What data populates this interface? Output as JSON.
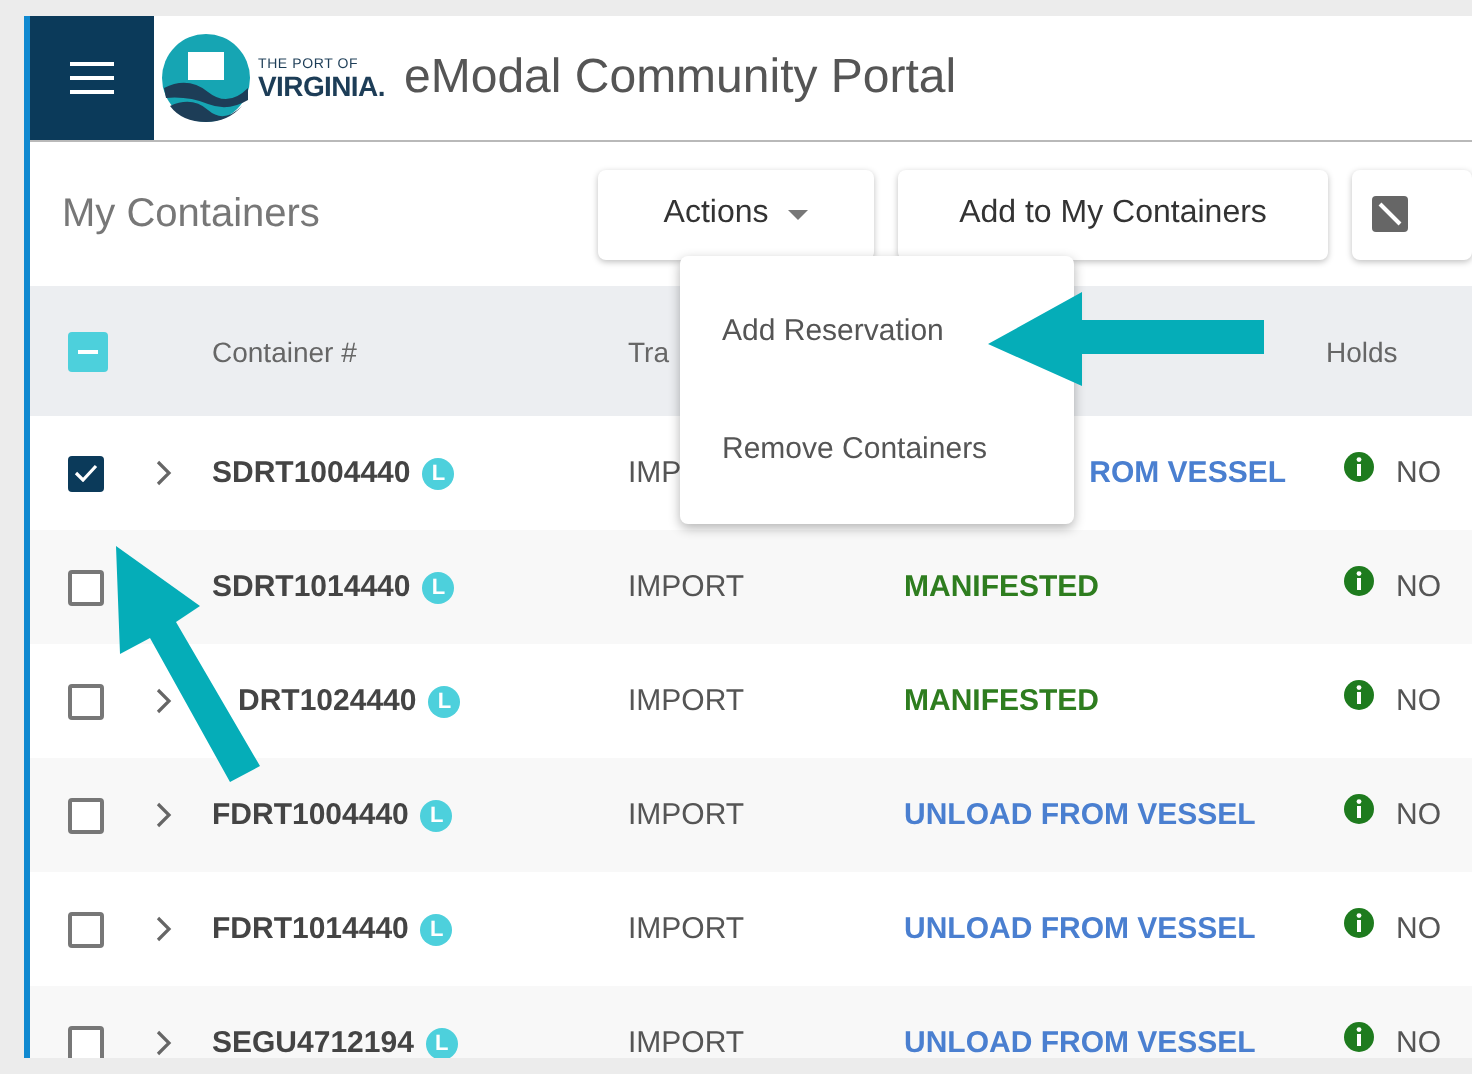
{
  "header": {
    "logo": {
      "line1": "THE PORT OF",
      "line2": "VIRGINIA."
    },
    "title": "eModal Community Portal"
  },
  "toolbar": {
    "title": "My Containers",
    "buttons": [
      {
        "label": "Actions",
        "kind": "dropdown"
      },
      {
        "label": "Add to My Containers",
        "kind": "plain"
      },
      {
        "kind": "icon"
      }
    ]
  },
  "menu": {
    "items": [
      {
        "label": "Add Reservation"
      },
      {
        "label": "Remove Containers"
      }
    ]
  },
  "table": {
    "header_checkbox": {
      "indeterminate": true
    },
    "columns": [
      "Container #",
      "Tra",
      "",
      "Holds"
    ],
    "rows": [
      {
        "checked": true,
        "expandable": true,
        "container": "SDRT1004440",
        "badge": "L",
        "trade": "IMP",
        "status": "ROM VESSEL",
        "color": "#4a7fd0",
        "status_covered": true,
        "hold": "NO"
      },
      {
        "checked": false,
        "expandable": false,
        "container": "SDRT1014440",
        "badge": "L",
        "trade": "IMPORT",
        "status": "MANIFESTED",
        "color": "#2e7d1f",
        "status_covered": false,
        "hold": "NO"
      },
      {
        "checked": false,
        "expandable": true,
        "container": "DRT1024440",
        "container_covered": true,
        "badge": "L",
        "trade": "IMPORT",
        "status": "MANIFESTED",
        "color": "#2e7d1f",
        "status_covered": false,
        "hold": "NO"
      },
      {
        "checked": false,
        "expandable": true,
        "container": "FDRT1004440",
        "badge": "L",
        "trade": "IMPORT",
        "status": "UNLOAD FROM VESSEL",
        "color": "#4a7fd0",
        "status_covered": false,
        "hold": "NO"
      },
      {
        "checked": false,
        "expandable": true,
        "container": "FDRT1014440",
        "badge": "L",
        "trade": "IMPORT",
        "status": "UNLOAD FROM VESSEL",
        "color": "#4a7fd0",
        "status_covered": false,
        "hold": "NO"
      },
      {
        "checked": false,
        "expandable": true,
        "container": "SEGU4712194",
        "badge": "L",
        "trade": "IMPORT",
        "status": "UNLOAD FROM VESSEL",
        "color": "#4a7fd0",
        "status_covered": false,
        "hold": "NO"
      }
    ]
  }
}
